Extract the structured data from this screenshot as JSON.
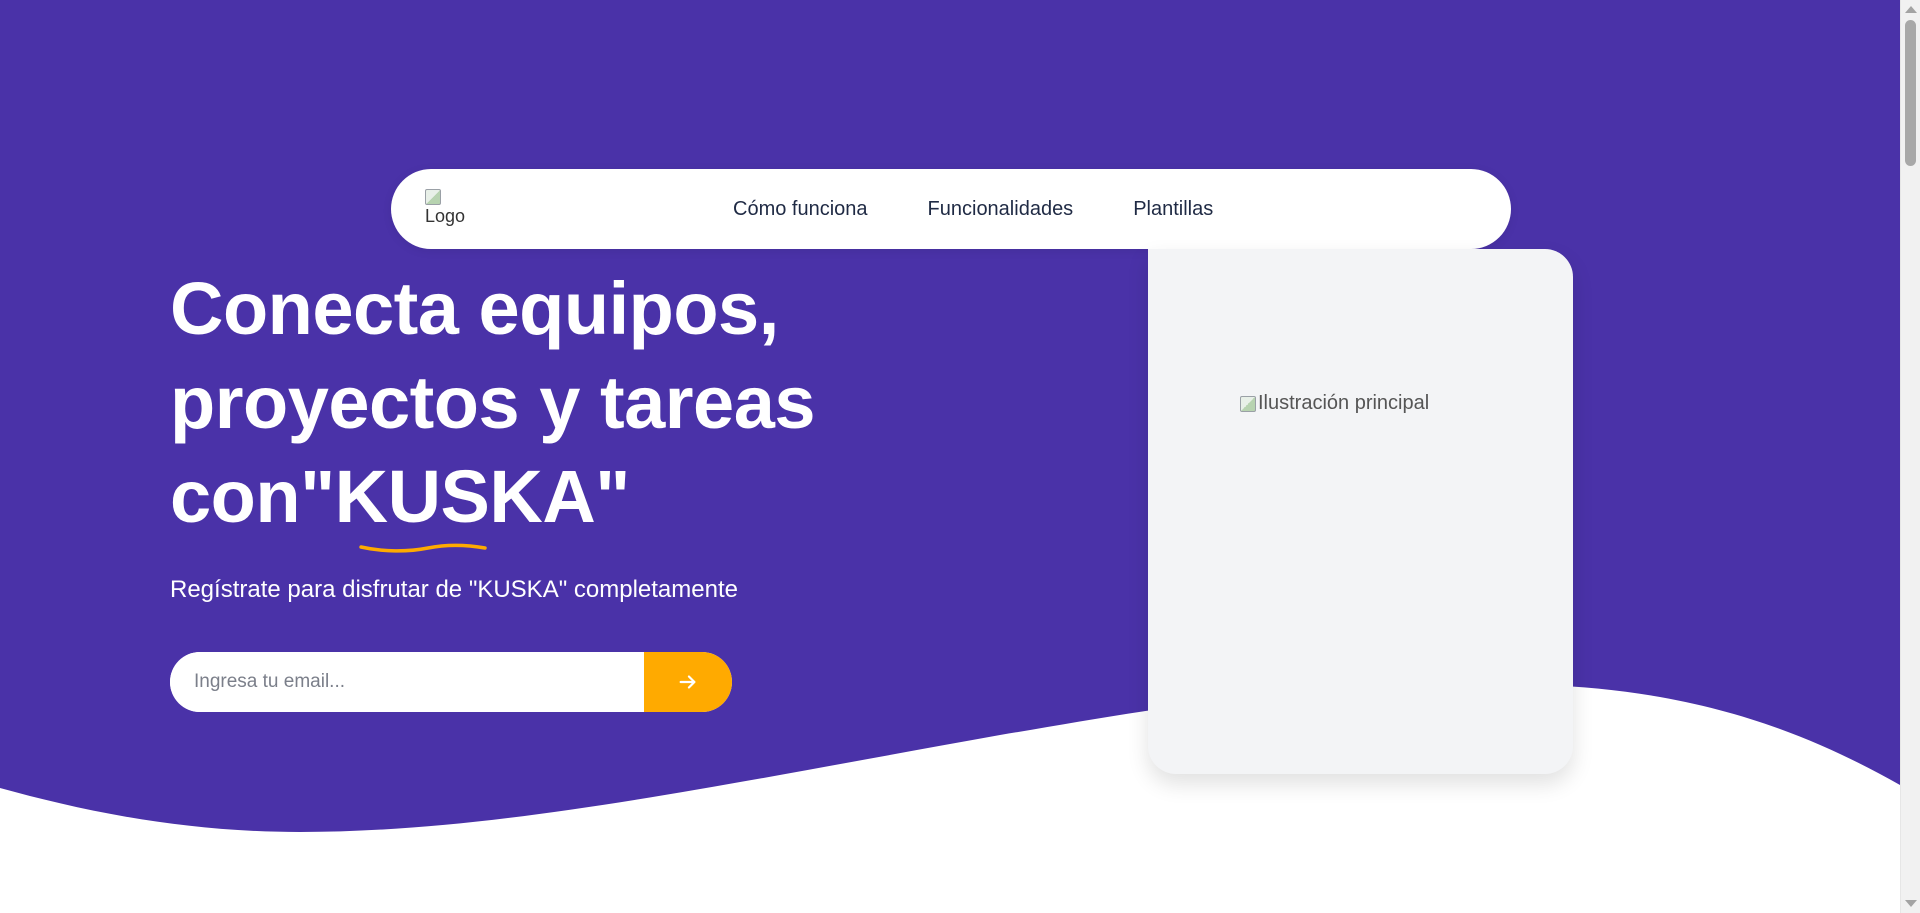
{
  "colors": {
    "hero_background": "#4A32A8",
    "accent": "#FFAA00",
    "card_background": "#F3F4F6",
    "text_light": "#FFFFFF",
    "nav_text": "#1F2A44"
  },
  "header": {
    "logo_alt": "Logo",
    "nav_items": [
      {
        "label": "Cómo funciona"
      },
      {
        "label": "Funcionalidades"
      },
      {
        "label": "Plantillas"
      }
    ]
  },
  "hero": {
    "headline_line1": "Conecta equipos,",
    "headline_line2": "proyectos y tareas",
    "headline_prefix": "con",
    "headline_brand": "\"KUSKA\"",
    "subtitle": "Regístrate para disfrutar de \"KUSKA\" completamente",
    "email_placeholder": "Ingresa tu email...",
    "email_value": "",
    "submit_icon": "arrow-right-icon"
  },
  "illustration": {
    "alt": "Ilustración principal"
  }
}
